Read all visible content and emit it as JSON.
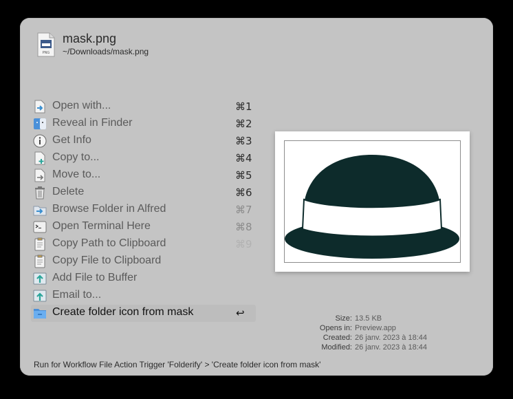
{
  "header": {
    "filename": "mask.png",
    "path": "~/Downloads/mask.png",
    "file_icon_label": "PNG"
  },
  "actions": [
    {
      "label": "Open with...",
      "shortcut": "⌘1",
      "icon": "open-with-icon"
    },
    {
      "label": "Reveal in Finder",
      "shortcut": "⌘2",
      "icon": "finder-icon"
    },
    {
      "label": "Get Info",
      "shortcut": "⌘3",
      "icon": "info-icon"
    },
    {
      "label": "Copy to...",
      "shortcut": "⌘4",
      "icon": "copy-to-icon"
    },
    {
      "label": "Move to...",
      "shortcut": "⌘5",
      "icon": "move-to-icon"
    },
    {
      "label": "Delete",
      "shortcut": "⌘6",
      "icon": "trash-icon"
    },
    {
      "label": "Browse Folder in Alfred",
      "shortcut": "⌘7",
      "icon": "browse-folder-icon"
    },
    {
      "label": "Open Terminal Here",
      "shortcut": "⌘8",
      "icon": "terminal-icon"
    },
    {
      "label": "Copy Path to Clipboard",
      "shortcut": "⌘9",
      "icon": "clipboard-icon"
    },
    {
      "label": "Copy File to Clipboard",
      "shortcut": "",
      "icon": "clipboard-icon"
    },
    {
      "label": "Add File to Buffer",
      "shortcut": "",
      "icon": "buffer-icon"
    },
    {
      "label": "Email to...",
      "shortcut": "",
      "icon": "email-icon"
    },
    {
      "label": "Create folder icon from mask",
      "shortcut": "↩",
      "icon": "folder-icon"
    }
  ],
  "selected_index": 12,
  "metadata": {
    "size_label": "Size:",
    "size": "13.5 KB",
    "opens_label": "Opens in:",
    "opens": "Preview.app",
    "created_label": "Created:",
    "created": "26 janv. 2023 à 18:44",
    "modified_label": "Modified:",
    "modified": "26 janv. 2023 à 18:44"
  },
  "footer": "Run for Workflow File Action Trigger 'Folderify' > 'Create folder icon from mask'",
  "colors": {
    "window_bg": "#c4c4c4",
    "hat": "#0d2b2b",
    "selection": "#bdbdbd",
    "accent_blue": "#4a90d9"
  }
}
